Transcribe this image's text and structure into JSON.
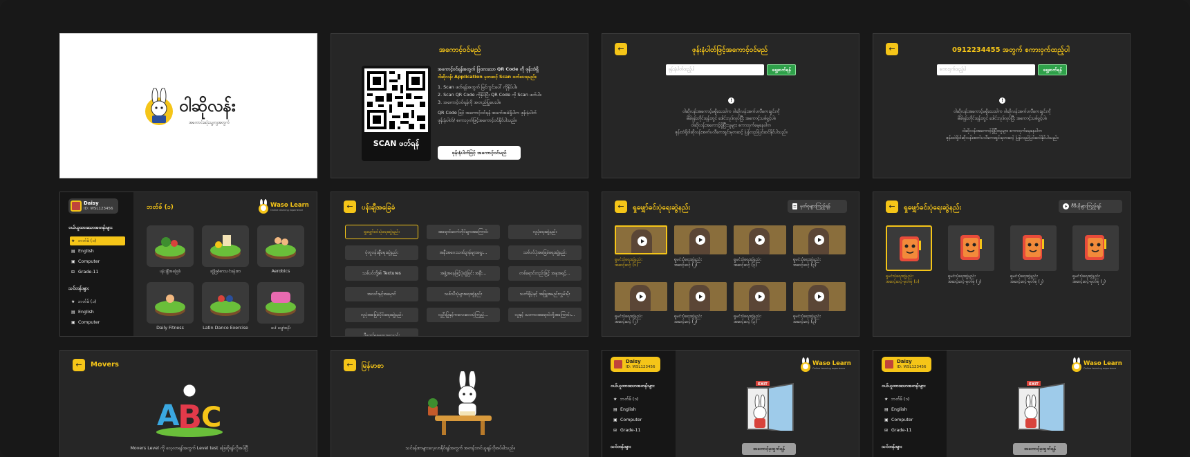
{
  "brand": {
    "app_name": "ဝါဆိုလန်း",
    "tagline": "အကောင်းဆုံးသူ့ကျအတွက်",
    "waso_title": "Waso Learn",
    "waso_sub": "Online learning experience",
    "accent_color": "#f5c518"
  },
  "qr_panel": {
    "title": "အကောင့်ဝင်မည်",
    "scan_label": "SCAN ဖတ်ရန်",
    "lines": [
      "အကောင့်ဝင်ရန်အတွက် ပြထားသော QR Code ကို ဖုန်းထဲရှိ",
      "ဝါဆိုလန်း Application မှတဆင့် Scan ဖတ်ပေးရမည်။",
      "1. Scan ဖတ်ရန်အတွက် မြင်ကွင်းပေါ် ကိုနှိပ်ပါ။",
      "2. Scan QR Code ကိုနှိပ်ပြီး QR Code ကို Scan ဖတ်ပါ။",
      "3. အကောင့်ဝင်ရန်ကို အတည်ပြုပေးပါ။",
      "QR Code ဖြင့် အကောင့်ဝင်ရန် အခက်အခဲရှိပါက ဖုန်းနံပါတ်",
      "ဖုန်းနံပါတ်/ စကားဝှက်ဖြင့်အကောင့်ဝင်နိုင်ပါသည်။"
    ],
    "phone_login_button": "ဖုန်းနံပါတ်ဖြင့် အကောင့်ဝင်မည်"
  },
  "phone_panel": {
    "title": "ဖုန်းနံပါတ်ဖြင့်အကောင့်ဝင်မည်",
    "input_placeholder": "ဖုန်းနံပါတ်ထည့်ပါ",
    "button": "ရှေ့ဆက်ရန်",
    "info": [
      "ဝါဆိုလန်းအကောင့်မရှိသေးပါက ဝါဆိုလန်းအက်ပလီကေးရှင်းကို",
      "မိမိဖုန်းတိုင်းရန်းတွင် ဒေါင်းလုဒ်လုပ်ပြီး အကောင့်သစ်ဖွင့်ပါ။",
      "ဝါဆိုလန်းအကောင့်ရှိပြီးသူများ စကားဝှက်မေ့နေပါက",
      "ဖုန်းထဲရှိဝါဆိုလန်းအက်ပလီကေးရှင်းမှတဆင့် ပြန်လည်ပြင်ဆင်နိုင်ပါသည်။"
    ]
  },
  "password_panel": {
    "title": "0912234455 အတွက် စကားဝှက်ထည့်ပါ",
    "input_placeholder": "စကားဝှက်ထည့်ပါ",
    "button": "ရှေ့ဆက်ရန်",
    "info": [
      "ဝါဆိုလန်းအကောင့်မရှိသေးပါက ဝါဆိုလန်းအက်ပလီကေးရှင်းကို",
      "မိမိဖုန်းတိုင်းရန်းတွင် ဒေါင်းလုဒ်လုပ်ပြီး အကောင့်သစ်ဖွင့်ပါ။",
      "ဝါဆိုလန်းအကောင့်ရှိပြီးသူများ စကားဝှက်မေ့နေပါက",
      "ဖုန်းထဲရှိဝါဆိုလန်းအက်ပလီကေးရှင်းမှတဆင့် ပြန်လည်ပြင်ဆင်နိုင်ပါသည်။"
    ]
  },
  "profile": {
    "name": "Daisy",
    "id": "ID: WSL123456"
  },
  "sidebar": {
    "section1": "ဝယ်ယူထားသောအတန်းများ",
    "items1": [
      "ဘတ်ခ် (၁)",
      "English",
      "Computer",
      "Grade-11"
    ],
    "section2": "သင်တန်းများ",
    "items2": [
      "ဘတ်ခ် (၁)",
      "English",
      "Computer"
    ]
  },
  "dashboard": {
    "title": "ဘတ်ခ် (၁)",
    "tiles": [
      "ပန်းချီအခြေခံ",
      "ဆွဲခြစ်စာသင်ခန်းစာ",
      "Aerobics",
      "Daily Fitness",
      "Latin Dance Exercise",
      "ပေါ်ပျော်စနီး"
    ]
  },
  "list_panel": {
    "title": "ပန်းချီအခြေခံ",
    "chips": [
      "ရှုမျှော်ခင်းပုံရေးဆွဲနည်း",
      "အရောင်ဆက်တိုင်များအကြောင်း",
      "လူပုံရေးဆွဲနည်း",
      "ပုံတူပန်းချီရေးဆွဲနည်း",
      "အနီးအဝေးသဏ်ဍာန်များရွေး...",
      "သစ်ပင်ပုံအခြေခံရေးဆွဲနည်း",
      "သစ်ပင်တို့၏ Textures",
      "အဖွဲ့အနေဖြင့်ပုံဆွဲခြင်း အနီး...",
      "တစ်ရောင်တည်းဖြင့် အနုအရင့်...",
      "အလင်းနှင့်အမှောင်",
      "သစ်သီးပုံများရေးဆွဲနည်း",
      "သက်ရှိမဲ့နှင့် အဖြူအမည်းလွှမ်းမိုး",
      "လူပုံအခြေခံပိုင်းရေးဆွဲနည်း",
      "လူဦးပြုနှင့်ကလေးလေးပုံကြည့်...",
      "လူနှင့် သဘာဝအရောင်တို့အကြောင်း...",
      "ပီကော်စေဆေးရေးနည်း"
    ]
  },
  "video_panel": {
    "title": "ရှုမျှော်ခင်းပုံရေးဆွဲနည်း",
    "button": "မှတ်စုများကြည့်ရန်",
    "items": [
      [
        "ရှုမင်းပုံရေးဆွဲနည်း",
        "အဆင့်ဆင့် (၁)"
      ],
      [
        "ရှုမင်းပုံရေးဆွဲနည်း",
        "အဆင့်ဆင့် (၂)"
      ],
      [
        "ရှုမင်းပုံရေးဆွဲနည်း",
        "အဆင့်ဆင့် (၃)"
      ],
      [
        "ရှုမင်းပုံရေးဆွဲနည်း",
        "အဆင့်ဆင့် (၃)"
      ],
      [
        "ရှုမင်းပုံရေးဆွဲနည်း",
        "အဆင့်ဆင့် (၂)"
      ],
      [
        "ရှုမင်းပုံရေးဆွဲနည်း",
        "အဆင့်ဆင့် (၂)"
      ],
      [
        "ရှုမင်းပုံရေးဆွဲနည်း",
        "အဆင့်ဆင့် (၃)"
      ],
      [
        "ရှုမင်းပုံရေးဆွဲနည်း",
        "အဆင့်ဆင့် (၃)"
      ]
    ]
  },
  "notes_panel": {
    "title": "ရှုမျှော်ခင်းပုံရေးဆွဲနည်း",
    "button": "ဗီဒီယိုများကြည့်ရန်",
    "items": [
      [
        "ရှုမင်းပုံရေးဆွဲနည်း",
        "အဆင့်ဆင့်-မှတ်စု (၁)"
      ],
      [
        "ရှုမင်းပုံရေးဆွဲနည်း",
        "အဆင့်ဆင့်-မှတ်စု (၂)"
      ],
      [
        "ရှုမင်းပုံရေးဆွဲနည်း",
        "အဆင့်ဆင့်-မှတ်စု (၂)"
      ],
      [
        "ရှုမင်းပုံရေးဆွဲနည်း",
        "အဆင့်ဆင့်-မှတ်စု (၂)"
      ]
    ]
  },
  "movers_panel": {
    "title": "Movers",
    "caption": "Movers Level ကို လေ့လာရန်အတွက် Level test ဖြေဆိုရန်လိုအပ်ပြီ"
  },
  "myanmar_panel": {
    "title": "မြန်မာစာ",
    "caption": "သင်ခန်းစာများလေ့လာနိုင်ရန်အတွက် အတန်းတင်ယူရန်လိုအပ်ပါသည်။"
  },
  "exit_panels": {
    "exit_sign": "EXIT",
    "button": "အကောင့်မှထွက်ရန်"
  }
}
